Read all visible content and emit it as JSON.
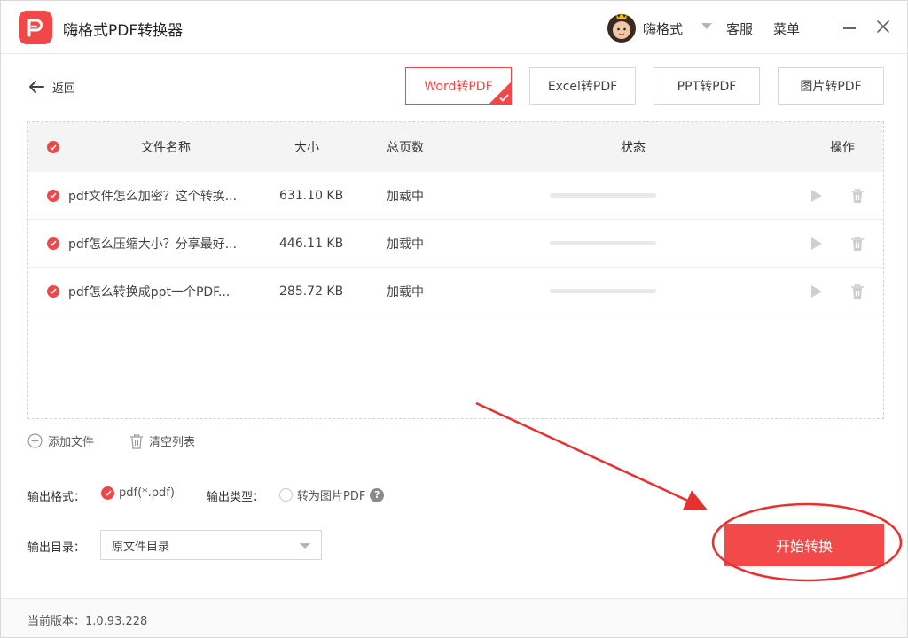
{
  "app": {
    "title": "嗨格式PDF转换器",
    "brand_color": "#f04848"
  },
  "titlebar": {
    "user_name": "嗨格式",
    "service": "客服",
    "menu": "菜单"
  },
  "back": {
    "label": "返回"
  },
  "tabs": [
    {
      "label": "Word转PDF",
      "active": true
    },
    {
      "label": "Excel转PDF",
      "active": false
    },
    {
      "label": "PPT转PDF",
      "active": false
    },
    {
      "label": "图片转PDF",
      "active": false
    }
  ],
  "table": {
    "headers": {
      "name": "文件名称",
      "size": "大小",
      "pages": "总页数",
      "status": "状态",
      "actions": "操作"
    },
    "rows": [
      {
        "name": "pdf文件怎么加密？这个转换...",
        "size": "631.10 KB",
        "pages": "加载中",
        "progress": 0
      },
      {
        "name": "pdf怎么压缩大小？分享最好...",
        "size": "446.11 KB",
        "pages": "加载中",
        "progress": 0
      },
      {
        "name": "pdf怎么转换成ppt一个PDF...",
        "size": "285.72 KB",
        "pages": "加载中",
        "progress": 0
      }
    ]
  },
  "list_actions": {
    "add_file": "添加文件",
    "clear_list": "清空列表"
  },
  "output": {
    "format_label": "输出格式：",
    "format_value": "pdf(*.pdf)",
    "type_label": "输出类型：",
    "type_option": "转为图片PDF",
    "dir_label": "输出目录：",
    "dir_value": "原文件目录"
  },
  "start_button": {
    "label": "开始转换"
  },
  "footer": {
    "version": "当前版本：1.0.93.228"
  }
}
